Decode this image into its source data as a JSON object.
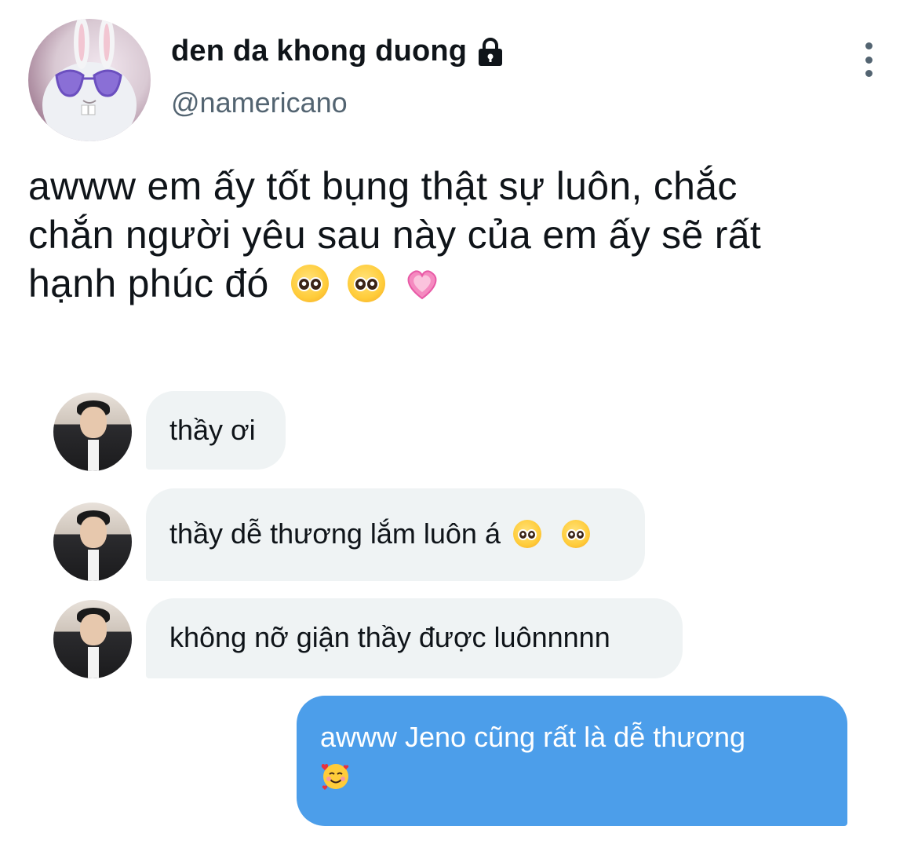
{
  "tweet": {
    "display_name": "den da khong duong",
    "handle": "@namericano",
    "text_line1": "awww em ấy tốt bụng thật sự luôn, chắc",
    "text_line2": "chắn người yêu sau này của em ấy sẽ rất",
    "text_line3": "hạnh phúc đó",
    "emojis": [
      "pleading-face-icon",
      "pleading-face-icon",
      "growing-heart-icon"
    ]
  },
  "messages": [
    {
      "text": "thầy ơi",
      "direction": "incoming"
    },
    {
      "text": "thầy dễ thương lắm luôn á",
      "direction": "incoming",
      "emojis": [
        "pleading-face-icon",
        "pleading-face-icon"
      ]
    },
    {
      "text": "không nỡ giận thầy được luônnnnn",
      "direction": "incoming"
    },
    {
      "text": "awww Jeno cũng rất là dễ thương",
      "direction": "outgoing",
      "emojis": [
        "smiling-face-with-hearts-icon"
      ]
    }
  ],
  "colors": {
    "text_primary": "#0f1419",
    "text_secondary": "#536471",
    "incoming_bubble": "#eff3f4",
    "outgoing_bubble": "#4c9eea"
  }
}
